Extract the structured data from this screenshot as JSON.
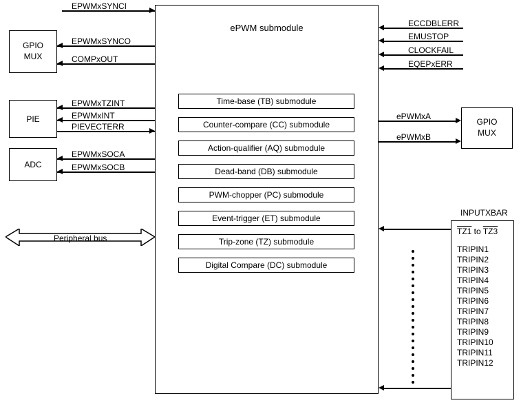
{
  "main": {
    "title": "ePWM submodule",
    "submodules": [
      "Time-base (TB) submodule",
      "Counter-compare (CC) submodule",
      "Action-qualifier (AQ) submodule",
      "Dead-band (DB) submodule",
      "PWM-chopper (PC) submodule",
      "Event-trigger (ET) submodule",
      "Trip-zone (TZ) submodule",
      "Digital Compare (DC) submodule"
    ]
  },
  "left_blocks": {
    "gpio_mux": "GPIO\nMUX",
    "pie": "PIE",
    "adc": "ADC"
  },
  "left_signals": {
    "synci": "EPWMxSYNCI",
    "synco": "EPWMxSYNCO",
    "compxout": "COMPxOUT",
    "tzint": "EPWMxTZINT",
    "xint": "EPWMxINT",
    "pievect": "PIEVECTERR",
    "soca": "EPWMxSOCA",
    "socb": "EPWMxSOCB"
  },
  "bus_label": "Peripheral bus",
  "top_right_signals": {
    "eccdblerr": "ECCDBLERR",
    "emustop": "EMUSTOP",
    "clockfail": "CLOCKFAIL",
    "eqepxerr": "EQEPxERR"
  },
  "right_gpio": {
    "label": "GPIO\nMUX",
    "a": "ePWMxA",
    "b": "ePWMxB"
  },
  "inputxbar": {
    "title": "INPUTXBAR",
    "tz": "TZ1 to TZ3",
    "tripins": [
      "TRIPIN1",
      "TRIPIN2",
      "TRIPIN3",
      "TRIPIN4",
      "TRIPIN5",
      "TRIPIN6",
      "TRIPIN7",
      "TRIPIN8",
      "TRIPIN9",
      "TRIPIN10",
      "TRIPIN11",
      "TRIPIN12"
    ]
  }
}
